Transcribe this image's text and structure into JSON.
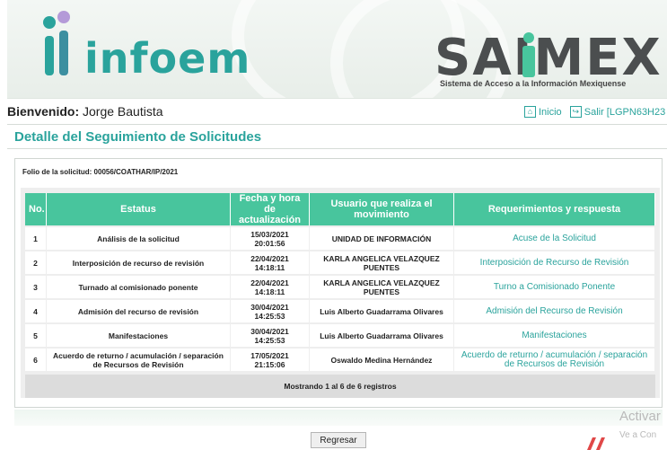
{
  "header": {
    "logo_left": "infoem",
    "logo_right": "SAIMEX",
    "logo_right_subtitle": "Sistema de Acceso a la Información Mexiquense",
    "brand_color": "#2aa39c"
  },
  "user": {
    "greeting": "Bienvenido:",
    "name": "Jorge Bautista"
  },
  "nav": {
    "home_label": "Inicio",
    "home_icon": "home-icon",
    "logout_label": "Salir [LGPN63H23",
    "logout_icon": "exit-icon"
  },
  "page_title": "Detalle del Seguimiento de Solicitudes",
  "folio": "Folio de la solicitud: 00056/COATHAR/IP/2021",
  "table": {
    "header_color": "#48c59d",
    "columns": [
      "No.",
      "Estatus",
      "Fecha y hora de actualización",
      "Usuario que realiza el movimiento",
      "Requerimientos y respuesta"
    ],
    "rows": [
      {
        "no": "1",
        "estatus": "Análisis de la solicitud",
        "fecha": "15/03/2021",
        "hora": "20:01:56",
        "usuario": "UNIDAD DE INFORMACIÓN",
        "respuesta": "Acuse de la Solicitud"
      },
      {
        "no": "2",
        "estatus": "Interposición de recurso de revisión",
        "fecha": "22/04/2021",
        "hora": "14:18:11",
        "usuario": "KARLA ANGELICA VELAZQUEZ PUENTES",
        "respuesta": "Interposición de Recurso de Revisión"
      },
      {
        "no": "3",
        "estatus": "Turnado al comisionado ponente",
        "fecha": "22/04/2021",
        "hora": "14:18:11",
        "usuario": "KARLA ANGELICA VELAZQUEZ PUENTES",
        "respuesta": "Turno a Comisionado Ponente"
      },
      {
        "no": "4",
        "estatus": "Admisión del recurso de revisión",
        "fecha": "30/04/2021",
        "hora": "14:25:53",
        "usuario": "Luis Alberto Guadarrama Olivares",
        "respuesta": "Admisión del Recurso de Revisión"
      },
      {
        "no": "5",
        "estatus": "Manifestaciones",
        "fecha": "30/04/2021",
        "hora": "14:25:53",
        "usuario": "Luis Alberto Guadarrama Olivares",
        "respuesta": "Manifestaciones"
      },
      {
        "no": "6",
        "estatus": "Acuerdo de returno / acumulación / separación de Recursos de Revisión",
        "fecha": "17/05/2021",
        "hora": "21:15:06",
        "usuario": "Oswaldo Medina Hernández",
        "respuesta": "Acuerdo de returno / acumulación / separación de Recursos de Revisión"
      }
    ],
    "footer": "Mostrando 1 al 6 de 6 registros"
  },
  "back_button": "Regresar",
  "watermark": {
    "line1": "Activar",
    "line2": "Ve a Con"
  }
}
